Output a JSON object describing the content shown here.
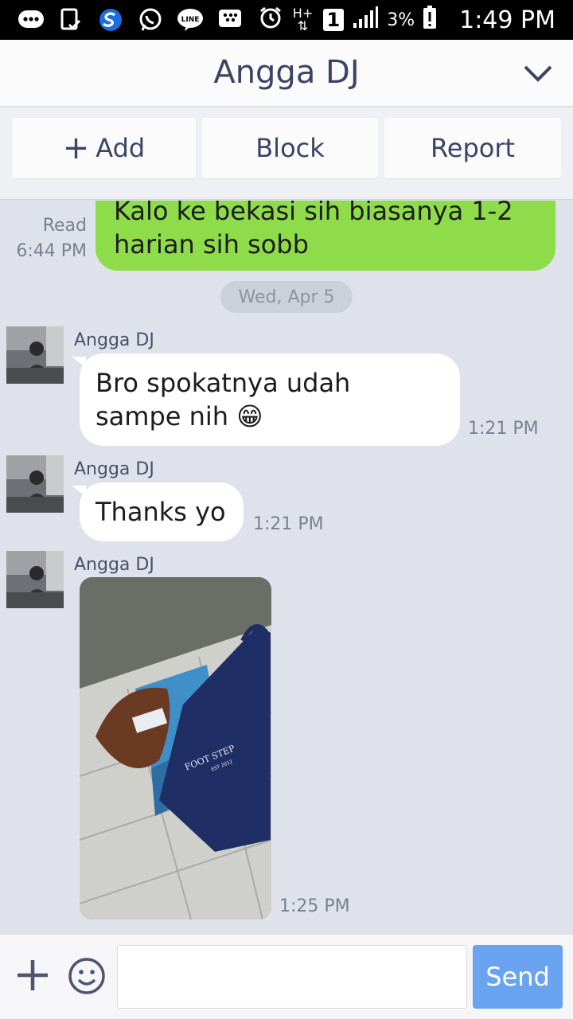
{
  "status_bar": {
    "time": "1:49 PM",
    "battery": "3%",
    "network": "H+",
    "sim_slot": "1",
    "line_badge": "LINE",
    "icons": [
      "bbm-icon",
      "clipboard-check-icon",
      "s-logo-icon",
      "whatsapp-icon",
      "line-icon",
      "blackberry-icon",
      "alarm-icon",
      "network-icon",
      "signal-icon",
      "battery-icon"
    ]
  },
  "header": {
    "title": "Angga DJ",
    "collapse_icon": "chevron-down-icon"
  },
  "actions": {
    "add_label": "Add",
    "block_label": "Block",
    "report_label": "Report"
  },
  "chat": {
    "sent": {
      "line1": "Kalo ke bekasi sih biasanya 1-2",
      "line2": "harian sih sobb",
      "read_label": "Read",
      "time": "6:44 PM"
    },
    "date_divider": "Wed, Apr 5",
    "messages": [
      {
        "sender": "Angga DJ",
        "line1": "Bro spokatnya udah",
        "line2": "sampe nih",
        "emoji": "😁",
        "time": "1:21 PM"
      },
      {
        "sender": "Angga DJ",
        "line1": "Thanks yo",
        "time": "1:21 PM"
      },
      {
        "sender": "Angga DJ",
        "photo_brand": "FOOT STEP",
        "photo_est": "EST 2012",
        "time": "1:25 PM"
      }
    ]
  },
  "input": {
    "placeholder": "",
    "send_label": "Send"
  },
  "colors": {
    "sent_bubble": "#8fdc4a",
    "send_button": "#6aa3f0",
    "title_text": "#3b4466",
    "chat_bg": "#dfe2ea"
  }
}
